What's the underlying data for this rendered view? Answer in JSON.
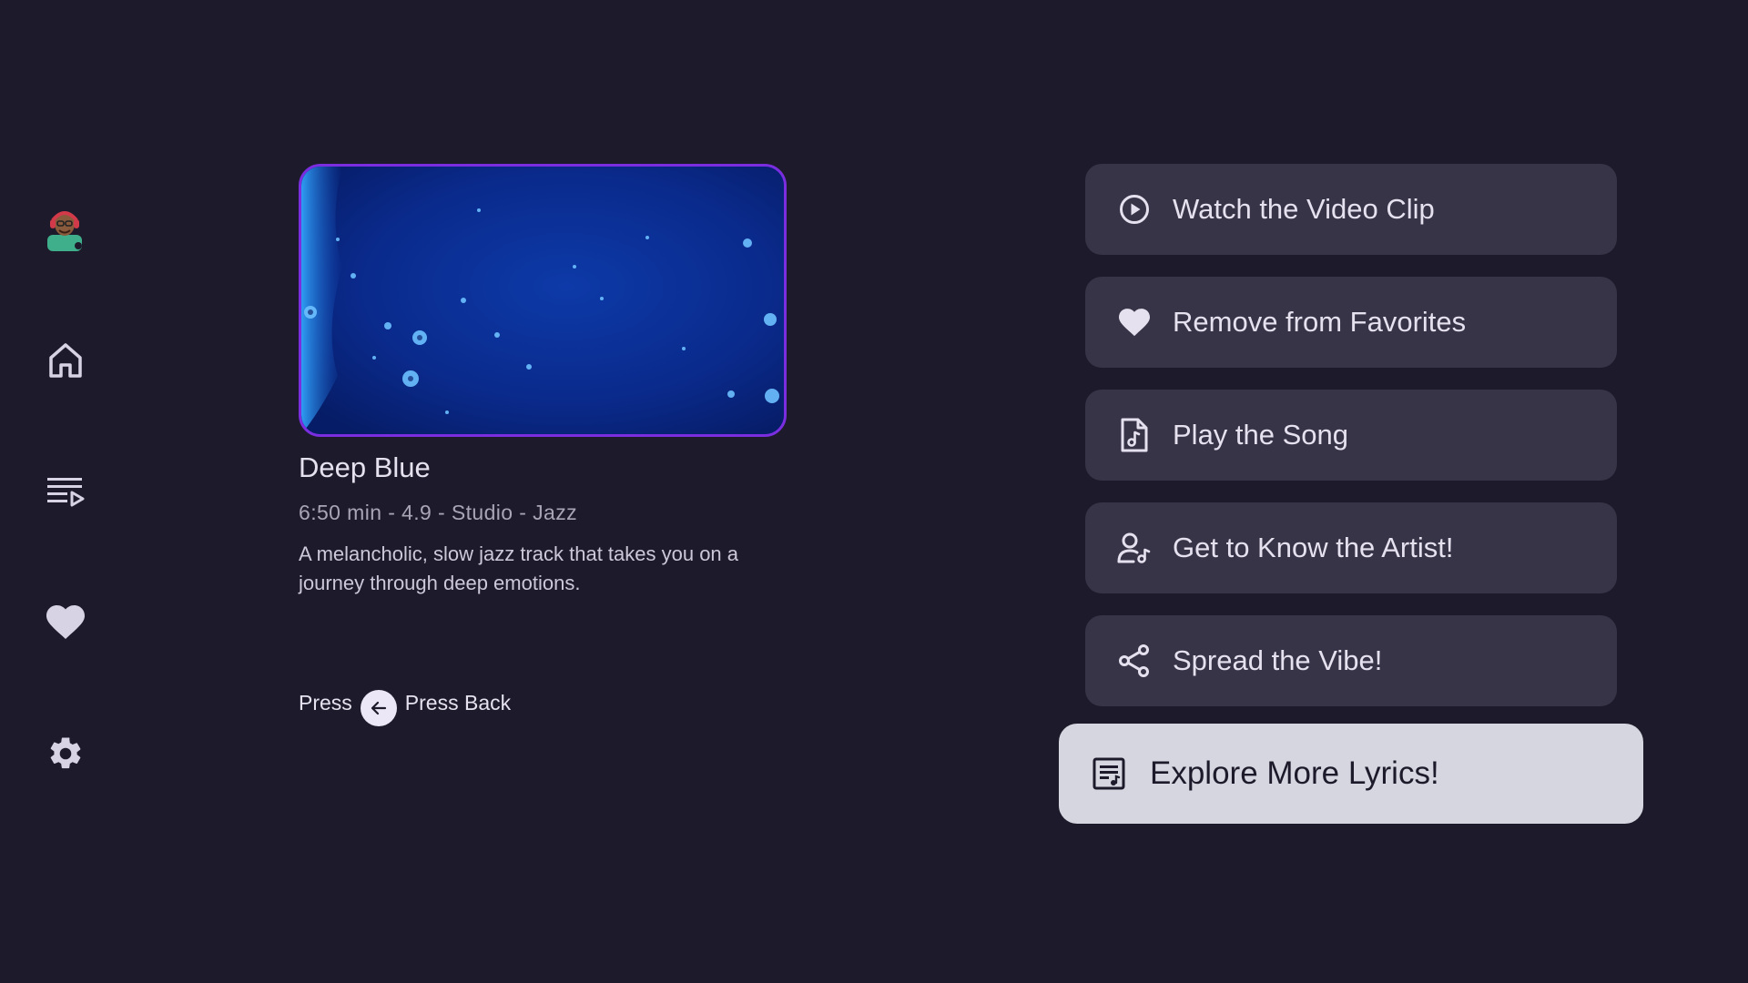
{
  "colors": {
    "background": "#1d1b2b",
    "card": "#383448",
    "card_focused": "#d5d6df",
    "thumbnail_border": "#7a2ee0",
    "text_primary": "#e6e1ef",
    "text_secondary": "#a9a4b6"
  },
  "sidebar": {
    "items": [
      {
        "name": "profile-avatar",
        "icon": "avatar"
      },
      {
        "name": "home",
        "icon": "home-icon"
      },
      {
        "name": "playlist",
        "icon": "playlist-icon"
      },
      {
        "name": "favorites",
        "icon": "heart-icon"
      },
      {
        "name": "settings",
        "icon": "gear-icon"
      }
    ]
  },
  "song": {
    "title": "Deep Blue",
    "meta": "6:50 min  - 4.9 - Studio - Jazz",
    "description": "A melancholic, slow jazz track that takes you on a journey through deep emotions."
  },
  "hint": {
    "prefix": "Press",
    "suffix": "Press Back",
    "icon": "arrow-left-icon"
  },
  "actions": [
    {
      "label": "Watch the Video Clip",
      "icon": "play-circle-icon"
    },
    {
      "label": "Remove from Favorites",
      "icon": "heart-icon"
    },
    {
      "label": "Play the Song",
      "icon": "music-file-icon"
    },
    {
      "label": "Get to Know the Artist!",
      "icon": "artist-icon"
    },
    {
      "label": "Spread the Vibe!",
      "icon": "share-icon"
    },
    {
      "label": "Explore More Lyrics!",
      "icon": "lyrics-icon",
      "focused": true
    }
  ]
}
